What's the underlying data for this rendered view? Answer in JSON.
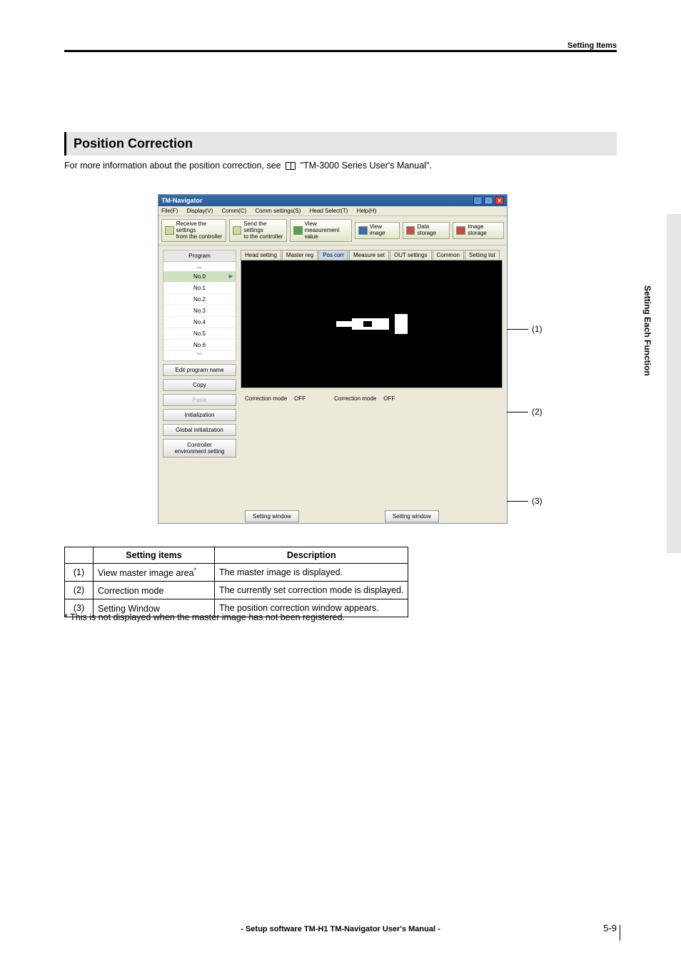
{
  "header": {
    "right_text": "Setting Items"
  },
  "section": {
    "title": "Position Correction",
    "intro_before": "For more information about the position correction, see",
    "intro_after": " \"TM-3000 Series User's Manual\"."
  },
  "side_tab": "Setting Each Function",
  "screenshot": {
    "title": "TM-Navigator",
    "menus": [
      "File(F)",
      "Display(V)",
      "Comm(C)",
      "Comm settings(S)",
      "Head Select(T)",
      "Help(H)"
    ],
    "toolbar": {
      "receive": "Receive the settings\nfrom the controller",
      "send": "Send the settings\nto the controller",
      "viewval": "View measurement\nvalue",
      "viewimg": "View image",
      "datastore": "Data storage",
      "imgstore": "Image storage"
    },
    "program_head": "Program",
    "programs": [
      "No.0",
      "No.1",
      "No.2",
      "No.3",
      "No.4",
      "No.5",
      "No.6"
    ],
    "left_buttons": {
      "edit": "Edit program name",
      "copy": "Copy",
      "paste": "Paste",
      "init": "Initialization",
      "ginit": "Global initialization",
      "ctrl": "Controller\nenvironment setting"
    },
    "tabs": [
      "Head setting",
      "Master reg",
      "Pos corr",
      "Measure set",
      "OUT settings",
      "Common",
      "Setting list"
    ],
    "mode_label": "Correction mode",
    "mode_value": "OFF",
    "setting_window_btn": "Setting window"
  },
  "callouts": {
    "c1": "(1)",
    "c2": "(2)",
    "c3": "(3)"
  },
  "table": {
    "head_items": "Setting items",
    "head_desc": "Description",
    "rows": [
      {
        "num": "(1)",
        "item": "View master image area",
        "item_sup": "*",
        "desc": "The master image is displayed."
      },
      {
        "num": "(2)",
        "item": "Correction mode",
        "item_sup": "",
        "desc": "The currently set correction mode is displayed."
      },
      {
        "num": "(3)",
        "item": "Setting Window",
        "item_sup": "",
        "desc": "The position correction window appears."
      }
    ]
  },
  "footnote": "*  This is not displayed when the master image has not been registered.",
  "footer": "- Setup software TM-H1 TM-Navigator User's Manual -",
  "page_number": "5-9"
}
